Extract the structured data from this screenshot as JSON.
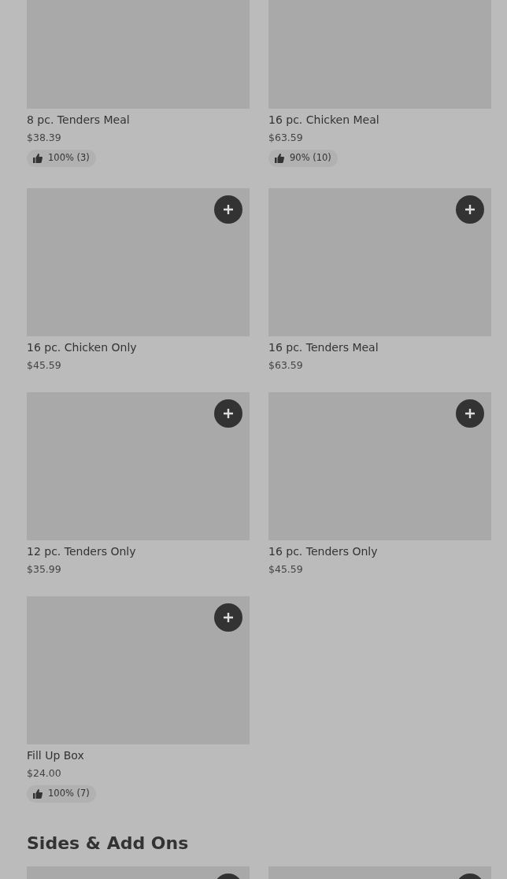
{
  "sections": [
    {
      "items": [
        {
          "name": "8 pc. Tenders Meal",
          "price": "$38.39",
          "rating": "100% (3)",
          "add_button": false
        },
        {
          "name": "16 pc. Chicken Meal",
          "price": "$63.59",
          "rating": "90% (10)",
          "add_button": false
        },
        {
          "name": "16 pc. Chicken Only",
          "price": "$45.59",
          "add_button": true
        },
        {
          "name": "16 pc. Tenders Meal",
          "price": "$63.59",
          "add_button": true
        },
        {
          "name": "12 pc. Tenders Only",
          "price": "$35.99",
          "add_button": true
        },
        {
          "name": "16 pc. Tenders Only",
          "price": "$45.59",
          "add_button": true
        },
        {
          "name": "Fill Up Box",
          "price": "$24.00",
          "rating": "100% (7)",
          "add_button": true
        }
      ]
    },
    {
      "title": "Sides & Add Ons",
      "items": [
        {
          "add_button": true
        },
        {
          "add_button": true
        }
      ]
    }
  ]
}
